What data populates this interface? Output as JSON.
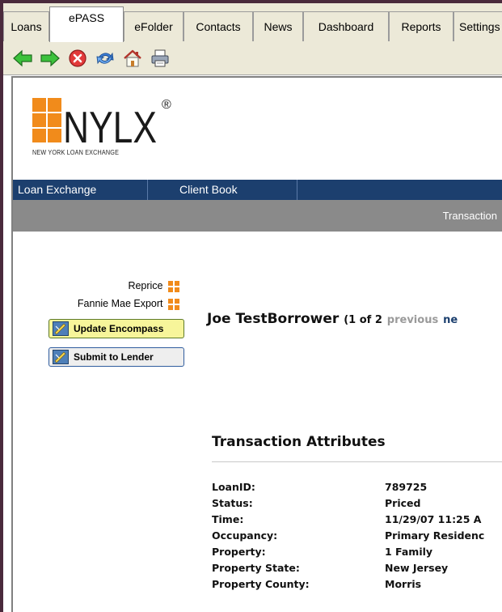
{
  "tabs": [
    {
      "label": "Loans"
    },
    {
      "label": "ePASS"
    },
    {
      "label": "eFolder"
    },
    {
      "label": "Contacts"
    },
    {
      "label": "News"
    },
    {
      "label": "Dashboard"
    },
    {
      "label": "Reports"
    },
    {
      "label": "Settings"
    }
  ],
  "toolbar": {
    "icons": [
      "back-arrow-icon",
      "forward-arrow-icon",
      "stop-icon",
      "refresh-icon",
      "home-icon",
      "print-icon"
    ]
  },
  "logo": {
    "wordmark": "NYLX",
    "registered": "®",
    "tagline": "NEW YORK LOAN EXCHANGE"
  },
  "nav": {
    "items": [
      {
        "label": "Loan Exchange"
      },
      {
        "label": "Client Book"
      }
    ]
  },
  "section_bar": {
    "label": "Transaction"
  },
  "side_links": [
    {
      "label": "Reprice"
    },
    {
      "label": "Fannie Mae Export"
    }
  ],
  "buttons": {
    "update": "Update Encompass",
    "submit": "Submit to Lender"
  },
  "borrower": {
    "name": "Joe TestBorrower",
    "position": "(1 of 2",
    "previous": "previous",
    "next": "ne"
  },
  "attributes": {
    "title": "Transaction Attributes",
    "rows": [
      {
        "label": "LoanID:",
        "value": "789725"
      },
      {
        "label": "Status:",
        "value": "Priced"
      },
      {
        "label": "Time:",
        "value": "11/29/07 11:25 A"
      },
      {
        "label": "Occupancy:",
        "value": "Primary Residenc"
      },
      {
        "label": "Property:",
        "value": "1 Family"
      },
      {
        "label": "Property State:",
        "value": "New Jersey"
      },
      {
        "label": "Property County:",
        "value": "Morris"
      }
    ]
  },
  "colors": {
    "nav_bg": "#1c3f6e",
    "section_bar_bg": "#8a8a8a",
    "logo_orange": "#f18b1b",
    "update_button_bg": "#f7f59a"
  }
}
